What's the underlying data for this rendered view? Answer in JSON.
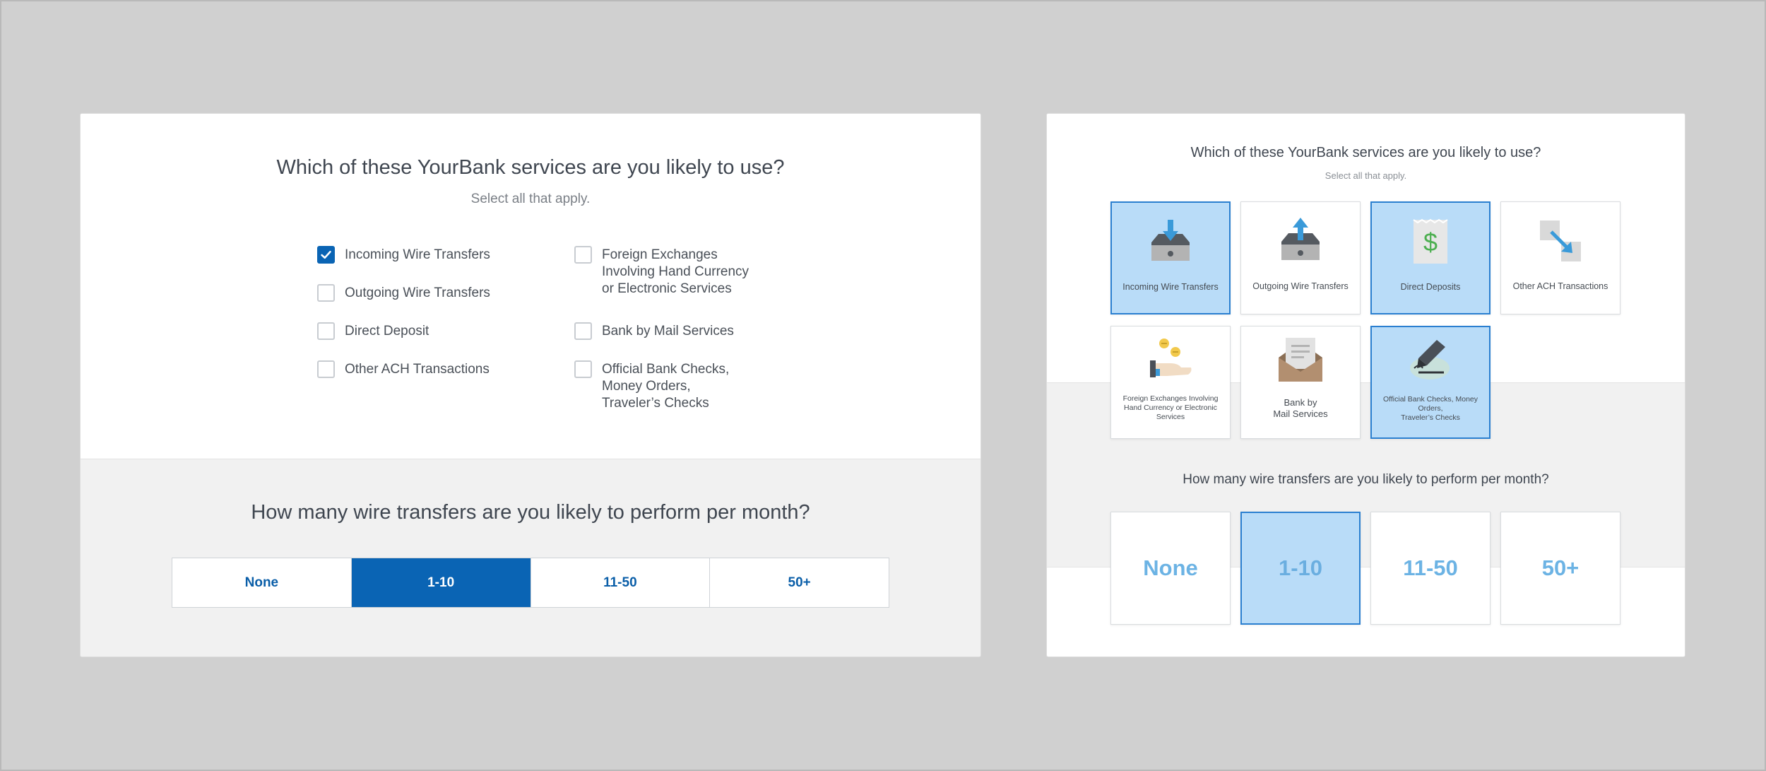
{
  "left": {
    "question1": "Which of these YourBank services are you likely to use?",
    "subtitle": "Select all that apply.",
    "col1": [
      {
        "label": "Incoming Wire Transfers",
        "checked": true
      },
      {
        "label": "Outgoing Wire Transfers",
        "checked": false
      },
      {
        "label": "Direct Deposit",
        "checked": false
      },
      {
        "label": "Other ACH Transactions",
        "checked": false
      }
    ],
    "col2": [
      {
        "line1": "Foreign Exchanges",
        "line2": "Involving Hand Currency",
        "line3": "or Electronic Services",
        "checked": false
      },
      {
        "line1": "Bank by Mail Services",
        "checked": false
      },
      {
        "line1": "Official Bank Checks,",
        "line2": "Money Orders,",
        "line3": "Traveler’s Checks",
        "checked": false
      }
    ],
    "question2": "How many wire transfers are you likely to perform per month?",
    "options": [
      "None",
      "1-10",
      "11-50",
      "50+"
    ],
    "selected_option": "1-10"
  },
  "right": {
    "question1": "Which of these YourBank services are you likely to use?",
    "subtitle": "Select all that apply.",
    "tiles": [
      {
        "label": "Incoming Wire Transfers",
        "icon": "inbox-download-icon",
        "selected": true
      },
      {
        "label": "Outgoing Wire Transfers",
        "icon": "inbox-upload-icon",
        "selected": false
      },
      {
        "label": "Direct Deposits",
        "icon": "dollar-receipt-icon",
        "selected": true
      },
      {
        "label": "Other ACH Transactions",
        "icon": "transfer-arrow-icon",
        "selected": false
      },
      {
        "line1": "Foreign Exchanges Involving",
        "line2": "Hand Currency or Electronic",
        "line3": "Services",
        "icon": "hand-coins-icon",
        "selected": false
      },
      {
        "line1": "Bank by",
        "line2": "Mail Services",
        "icon": "envelope-letter-icon",
        "selected": false
      },
      {
        "line1": "Official Bank Checks, Money",
        "line2": "Orders,",
        "line3": "Traveler’s Checks",
        "icon": "pen-signature-icon",
        "selected": true
      }
    ],
    "question2": "How many wire transfers are you likely to perform per month?",
    "options": [
      "None",
      "1-10",
      "11-50",
      "50+"
    ],
    "selected_option": "1-10"
  },
  "colors": {
    "primary_blue": "#0a64b4",
    "tile_selected_bg": "#b9dcf8",
    "tile_selected_border": "#2a7fd0",
    "number_text": "#6cb3e4",
    "icon_blue": "#3a9ad9",
    "icon_green": "#4caf50",
    "icon_gray": "#b3b3b3"
  }
}
